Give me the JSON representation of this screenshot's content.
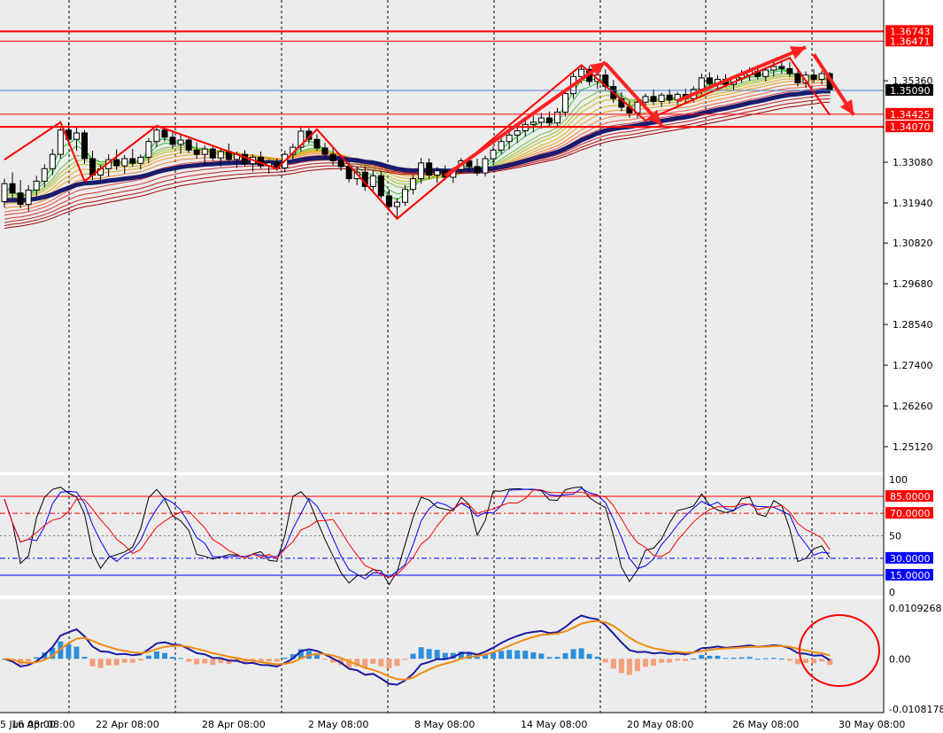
{
  "chart_data": [
    {
      "type": "candlestick",
      "panel": "price",
      "x_ticks": [
        "16 Apr 08:00",
        "22 Apr 08:00",
        "28 Apr 08:00",
        "2 May 08:00",
        "8 May 08:00",
        "14 May 08:00",
        "20 May 08:00",
        "26 May 08:00",
        "30 May 08:00",
        "5 Jun 08:00"
      ],
      "y_ticks": [
        "1.35360",
        "1.33080",
        "1.31940",
        "1.30820",
        "1.29680",
        "1.28540",
        "1.27400",
        "1.26260",
        "1.25120"
      ],
      "ylim": [
        1.244,
        1.3762
      ],
      "current_price": "1.35090",
      "levels": [
        {
          "value": 1.36743,
          "label": "1.36743",
          "color": "#ff0000"
        },
        {
          "value": 1.36471,
          "label": "1.36471",
          "color": "#ff0000"
        },
        {
          "value": 1.34425,
          "label": "1.34425",
          "color": "#ff0000"
        },
        {
          "value": 1.3407,
          "label": "1.34070",
          "color": "#ff0000"
        }
      ],
      "zigzag": [
        {
          "x": 0,
          "y": 1.3315
        },
        {
          "x": 7,
          "y": 1.342
        },
        {
          "x": 10,
          "y": 1.3255
        },
        {
          "x": 19,
          "y": 1.341
        },
        {
          "x": 34,
          "y": 1.329
        },
        {
          "x": 39,
          "y": 1.34
        },
        {
          "x": 49,
          "y": 1.315
        },
        {
          "x": 72,
          "y": 1.358
        },
        {
          "x": 80,
          "y": 1.3425
        },
        {
          "x": 98,
          "y": 1.36
        },
        {
          "x": 103,
          "y": 1.344
        }
      ],
      "candles": [
        [
          1.3198,
          1.3262,
          1.3182,
          1.3248
        ],
        [
          1.3248,
          1.328,
          1.3208,
          1.3222
        ],
        [
          1.3222,
          1.3258,
          1.318,
          1.319
        ],
        [
          1.319,
          1.3244,
          1.317,
          1.323
        ],
        [
          1.323,
          1.327,
          1.3212,
          1.3255
        ],
        [
          1.3255,
          1.3302,
          1.3238,
          1.329
        ],
        [
          1.329,
          1.3345,
          1.3272,
          1.333
        ],
        [
          1.333,
          1.341,
          1.3318,
          1.3398
        ],
        [
          1.3398,
          1.342,
          1.336,
          1.3372
        ],
        [
          1.3372,
          1.3408,
          1.334,
          1.339
        ],
        [
          1.339,
          1.3398,
          1.3304,
          1.3318
        ],
        [
          1.3318,
          1.334,
          1.3258,
          1.3272
        ],
        [
          1.3272,
          1.33,
          1.325,
          1.329
        ],
        [
          1.329,
          1.333,
          1.3268,
          1.3315
        ],
        [
          1.3315,
          1.3344,
          1.3286,
          1.3298
        ],
        [
          1.3298,
          1.3328,
          1.3276,
          1.3318
        ],
        [
          1.3318,
          1.3345,
          1.3295,
          1.3305
        ],
        [
          1.3305,
          1.333,
          1.3288,
          1.3322
        ],
        [
          1.3322,
          1.3376,
          1.3305,
          1.3366
        ],
        [
          1.3366,
          1.3412,
          1.335,
          1.3398
        ],
        [
          1.3398,
          1.3408,
          1.3366,
          1.3378
        ],
        [
          1.3378,
          1.3392,
          1.3346,
          1.3358
        ],
        [
          1.3358,
          1.3384,
          1.3332,
          1.337
        ],
        [
          1.337,
          1.338,
          1.3334,
          1.3342
        ],
        [
          1.3342,
          1.3364,
          1.3318,
          1.333
        ],
        [
          1.333,
          1.3354,
          1.33,
          1.3345
        ],
        [
          1.3345,
          1.3352,
          1.3312,
          1.332
        ],
        [
          1.332,
          1.3346,
          1.3296,
          1.3338
        ],
        [
          1.3338,
          1.336,
          1.331,
          1.3316
        ],
        [
          1.3316,
          1.3338,
          1.3292,
          1.333
        ],
        [
          1.333,
          1.3342,
          1.3296,
          1.3304
        ],
        [
          1.3304,
          1.333,
          1.3282,
          1.3322
        ],
        [
          1.3322,
          1.3338,
          1.329,
          1.3298
        ],
        [
          1.3298,
          1.3316,
          1.3276,
          1.3306
        ],
        [
          1.3306,
          1.3318,
          1.3284,
          1.3292
        ],
        [
          1.3292,
          1.334,
          1.328,
          1.333
        ],
        [
          1.333,
          1.336,
          1.3316,
          1.335
        ],
        [
          1.335,
          1.3408,
          1.3338,
          1.3395
        ],
        [
          1.3395,
          1.3404,
          1.336,
          1.3372
        ],
        [
          1.3372,
          1.3386,
          1.334,
          1.3348
        ],
        [
          1.3348,
          1.3362,
          1.3318,
          1.333
        ],
        [
          1.333,
          1.3348,
          1.33,
          1.3312
        ],
        [
          1.3312,
          1.3328,
          1.3284,
          1.3296
        ],
        [
          1.3296,
          1.3312,
          1.3252,
          1.3262
        ],
        [
          1.3262,
          1.3296,
          1.3244,
          1.328
        ],
        [
          1.328,
          1.3296,
          1.3228,
          1.324
        ],
        [
          1.324,
          1.3286,
          1.3226,
          1.327
        ],
        [
          1.327,
          1.3284,
          1.3206,
          1.3214
        ],
        [
          1.3214,
          1.3232,
          1.3172,
          1.3184
        ],
        [
          1.3184,
          1.3208,
          1.315,
          1.3196
        ],
        [
          1.3196,
          1.3244,
          1.3186,
          1.3232
        ],
        [
          1.3232,
          1.3272,
          1.3218,
          1.3262
        ],
        [
          1.3262,
          1.332,
          1.3248,
          1.3306
        ],
        [
          1.3306,
          1.3318,
          1.3262,
          1.3272
        ],
        [
          1.3272,
          1.3294,
          1.325,
          1.3284
        ],
        [
          1.3284,
          1.33,
          1.3258,
          1.3266
        ],
        [
          1.3266,
          1.3294,
          1.325,
          1.3288
        ],
        [
          1.3288,
          1.332,
          1.3276,
          1.3312
        ],
        [
          1.3312,
          1.3324,
          1.328,
          1.3296
        ],
        [
          1.3296,
          1.3318,
          1.327,
          1.3278
        ],
        [
          1.3278,
          1.3326,
          1.3268,
          1.3318
        ],
        [
          1.3318,
          1.3352,
          1.33,
          1.3342
        ],
        [
          1.3342,
          1.338,
          1.333,
          1.3366
        ],
        [
          1.3366,
          1.3392,
          1.3344,
          1.3384
        ],
        [
          1.3384,
          1.341,
          1.3362,
          1.3396
        ],
        [
          1.3396,
          1.3426,
          1.338,
          1.3414
        ],
        [
          1.3414,
          1.3438,
          1.3392,
          1.342
        ],
        [
          1.342,
          1.3446,
          1.3402,
          1.3432
        ],
        [
          1.3432,
          1.345,
          1.3408,
          1.3418
        ],
        [
          1.3418,
          1.346,
          1.3404,
          1.3448
        ],
        [
          1.3448,
          1.3512,
          1.3436,
          1.35
        ],
        [
          1.35,
          1.356,
          1.3486,
          1.3548
        ],
        [
          1.3548,
          1.358,
          1.3528,
          1.3568
        ],
        [
          1.3568,
          1.3578,
          1.3522,
          1.3534
        ],
        [
          1.3534,
          1.3566,
          1.3514,
          1.3552
        ],
        [
          1.3552,
          1.3568,
          1.351,
          1.352
        ],
        [
          1.352,
          1.3538,
          1.3474,
          1.3486
        ],
        [
          1.3486,
          1.3504,
          1.345,
          1.3462
        ],
        [
          1.3462,
          1.348,
          1.3432,
          1.3446
        ],
        [
          1.3446,
          1.3488,
          1.3432,
          1.3476
        ],
        [
          1.3476,
          1.35,
          1.3458,
          1.3492
        ],
        [
          1.3492,
          1.3512,
          1.3468,
          1.3478
        ],
        [
          1.3478,
          1.3502,
          1.3462,
          1.3496
        ],
        [
          1.3496,
          1.3512,
          1.3472,
          1.3482
        ],
        [
          1.3482,
          1.3504,
          1.3468,
          1.3498
        ],
        [
          1.3498,
          1.3514,
          1.3474,
          1.3486
        ],
        [
          1.3486,
          1.352,
          1.3476,
          1.3512
        ],
        [
          1.3512,
          1.3556,
          1.3498,
          1.3544
        ],
        [
          1.3544,
          1.356,
          1.3516,
          1.3528
        ],
        [
          1.3528,
          1.3552,
          1.3514,
          1.354
        ],
        [
          1.354,
          1.3554,
          1.3518,
          1.3526
        ],
        [
          1.3526,
          1.355,
          1.351,
          1.3544
        ],
        [
          1.3544,
          1.3566,
          1.353,
          1.3552
        ],
        [
          1.3552,
          1.3574,
          1.3536,
          1.3562
        ],
        [
          1.3562,
          1.358,
          1.354,
          1.3548
        ],
        [
          1.3548,
          1.3574,
          1.3534,
          1.3566
        ],
        [
          1.3566,
          1.359,
          1.3548,
          1.3576
        ],
        [
          1.3576,
          1.3594,
          1.3556,
          1.357
        ],
        [
          1.357,
          1.3588,
          1.3546,
          1.3556
        ],
        [
          1.3556,
          1.3572,
          1.352,
          1.353
        ],
        [
          1.353,
          1.3562,
          1.3516,
          1.3552
        ],
        [
          1.3552,
          1.3568,
          1.353,
          1.354
        ],
        [
          1.354,
          1.3564,
          1.3526,
          1.3556
        ],
        [
          1.3556,
          1.356,
          1.35,
          1.3509
        ]
      ]
    },
    {
      "type": "line",
      "panel": "oscillator",
      "ylim": [
        0,
        100
      ],
      "y_ticks": [
        "100",
        "50",
        "0"
      ],
      "levels": [
        {
          "value": 85,
          "label": "85.0000",
          "color": "#ff0000"
        },
        {
          "value": 70,
          "label": "70.0000",
          "color": "#ff0000"
        },
        {
          "value": 30,
          "label": "30.0000",
          "color": "#0000ff"
        },
        {
          "value": 15,
          "label": "15.0000",
          "color": "#0000ff"
        }
      ]
    },
    {
      "type": "bar",
      "panel": "macd",
      "ylim": [
        -0.010818,
        0.010927
      ],
      "y_ticks": [
        "0.0109268",
        "0.00",
        "-0.0108178"
      ]
    }
  ]
}
